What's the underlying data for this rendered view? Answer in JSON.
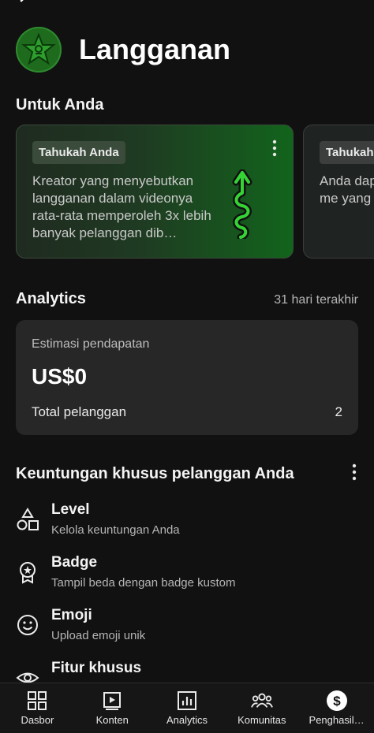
{
  "header": {
    "title": "Langganan",
    "logo_icon": "star-badge-icon"
  },
  "for_you": {
    "title": "Untuk Anda",
    "cards": [
      {
        "chip": "Tahukah Anda",
        "text": "Kreator yang menyebutkan langganan dalam videonya rata-rata memperoleh 3x lebih banyak pelanggan dib…"
      },
      {
        "chip": "Tahukah A",
        "text": "Anda dap Shorts kh untuk me yang ring"
      }
    ]
  },
  "analytics": {
    "title": "Analytics",
    "range": "31 hari terakhir",
    "revenue_label": "Estimasi pendapatan",
    "revenue_value": "US$0",
    "subscribers_label": "Total pelanggan",
    "subscribers_value": "2"
  },
  "perks": {
    "title": "Keuntungan khusus pelanggan Anda",
    "items": [
      {
        "name": "Level",
        "desc": "Kelola keuntungan Anda",
        "icon": "shapes-icon"
      },
      {
        "name": "Badge",
        "desc": "Tampil beda dengan badge kustom",
        "icon": "badge-icon"
      },
      {
        "name": "Emoji",
        "desc": "Upload emoji unik",
        "icon": "emoji-icon"
      },
      {
        "name": "Fitur khusus",
        "desc": "",
        "icon": "eye-icon"
      }
    ]
  },
  "nav": {
    "items": [
      {
        "label": "Dasbor",
        "icon": "dashboard-icon"
      },
      {
        "label": "Konten",
        "icon": "content-icon"
      },
      {
        "label": "Analytics",
        "icon": "analytics-icon"
      },
      {
        "label": "Komunitas",
        "icon": "community-icon"
      },
      {
        "label": "Penghasil…",
        "icon": "earn-icon"
      }
    ]
  },
  "colors": {
    "accent_green": "#1e6b1e",
    "background": "#111111",
    "card": "#272727"
  }
}
